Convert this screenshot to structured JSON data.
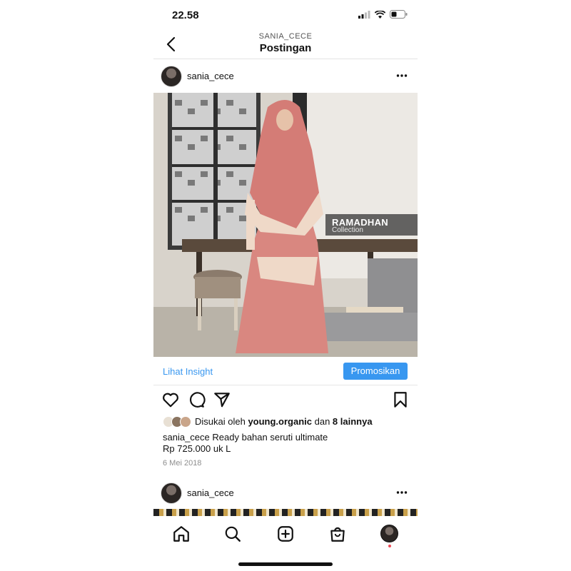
{
  "status_bar": {
    "time": "22.58"
  },
  "header": {
    "subtitle": "SANIA_CECE",
    "title": "Postingan"
  },
  "post": {
    "username": "sania_cece",
    "image_overlay": {
      "line1": "RAMADHAN",
      "line2": "Collection"
    },
    "insight_label": "Lihat Insight",
    "promote_label": "Promosikan",
    "likes": {
      "prefix": "Disukai oleh ",
      "user": "young.organic",
      "middle": " dan ",
      "others": "8 lainnya"
    },
    "caption": {
      "user": "sania_cece",
      "line1": " Ready bahan seruti ultimate",
      "line2": "Rp 725.000 uk L"
    },
    "date": "6 Mei 2018"
  },
  "next_post": {
    "username": "sania_cece"
  },
  "colors": {
    "accent": "#3897f0",
    "notification": "#ed4956"
  },
  "icons": {
    "back": "chevron-left-icon",
    "more": "more-horizontal-icon",
    "like": "heart-icon",
    "comment": "comment-icon",
    "share": "paper-plane-icon",
    "save": "bookmark-icon",
    "nav": [
      "home-icon",
      "search-icon",
      "add-post-icon",
      "shop-icon",
      "profile-avatar"
    ]
  }
}
